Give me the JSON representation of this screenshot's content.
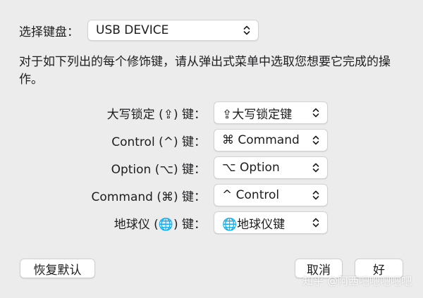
{
  "keyboard": {
    "label": "选择键盘：",
    "selected": "USB DEVICE"
  },
  "description": "对于如下列出的每个修饰键，请从弹出式菜单中选取您想要它完成的操作。",
  "modifiers": [
    {
      "label": "大写锁定 (⇪) 键：",
      "value": "⇪大写锁定键",
      "icon": "caps-lock-icon"
    },
    {
      "label": "Control (^) 键：",
      "value": "⌘ Command",
      "icon": "command-icon"
    },
    {
      "label": "Option (⌥) 键：",
      "value": "⌥ Option",
      "icon": "option-icon"
    },
    {
      "label": "Command (⌘) 键：",
      "value": "^ Control",
      "icon": "control-icon"
    },
    {
      "label": "地球仪 (🌐) 键：",
      "value": "🌐地球仪键",
      "icon": "globe-icon"
    }
  ],
  "buttons": {
    "restore": "恢复默认",
    "cancel": "取消",
    "ok": "好"
  },
  "watermark": "知乎 @阿西吧吧吧吧吧",
  "colors": {
    "background": "#ececec",
    "popup_bg": "#ffffff",
    "text": "#1d1d1f",
    "border": "#d2d2d2"
  }
}
